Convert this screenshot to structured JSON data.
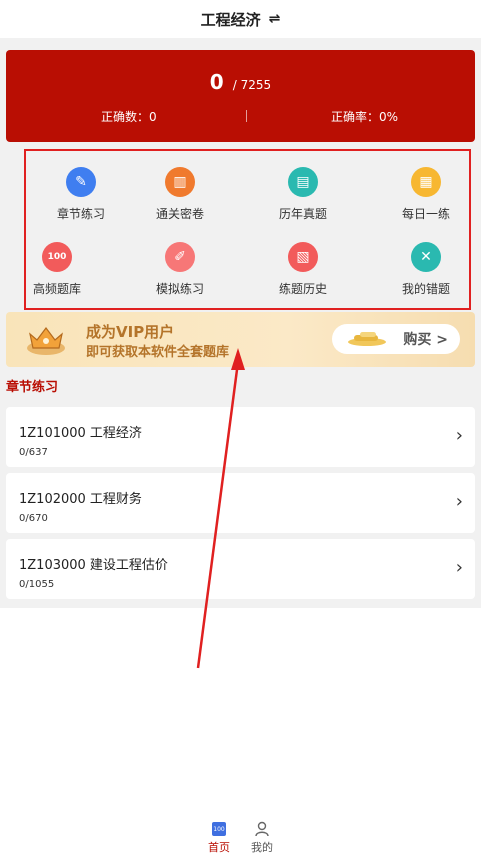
{
  "header": {
    "title": "工程经济",
    "swap_icon": "⇌"
  },
  "score": {
    "current": "0",
    "total": "/ 7255",
    "correct_count": "正确数：0",
    "correct_rate": "正确率：0%"
  },
  "grid": [
    {
      "label": "章节练习",
      "icon": "edit-icon",
      "color": "#3f7ef0",
      "glyph": "✎"
    },
    {
      "label": "通关密卷",
      "icon": "book-icon",
      "color": "#f07a2e",
      "glyph": "▥"
    },
    {
      "label": "历年真题",
      "icon": "document-icon",
      "color": "#2ab9b0",
      "glyph": "▤"
    },
    {
      "label": "每日一练",
      "icon": "calendar-icon",
      "color": "#f7b731",
      "glyph": "▦"
    },
    {
      "label": "高频题库",
      "icon": "hundred-icon",
      "color": "#f25b5b",
      "glyph": "100"
    },
    {
      "label": "模拟练习",
      "icon": "pen-icon",
      "color": "#f77777",
      "glyph": "✐"
    },
    {
      "label": "练题历史",
      "icon": "history-icon",
      "color": "#f25b5b",
      "glyph": "▧"
    },
    {
      "label": "我的错题",
      "icon": "wrong-book-icon",
      "color": "#2ab9b0",
      "glyph": "✕"
    }
  ],
  "vip": {
    "title": "成为VIP用户",
    "subtitle": "即可获取本软件全套题库",
    "buy_label": "购买 >"
  },
  "section_title": "章节练习",
  "chapters": [
    {
      "name": "1Z101000  工程经济",
      "progress": "0/637"
    },
    {
      "name": "1Z102000  工程财务",
      "progress": "0/670"
    },
    {
      "name": "1Z103000  建设工程估价",
      "progress": "0/1055"
    }
  ],
  "tabs": {
    "home": "首页",
    "mine": "我的"
  },
  "colors": {
    "primary": "#b90e03",
    "annotation": "#e02020"
  }
}
